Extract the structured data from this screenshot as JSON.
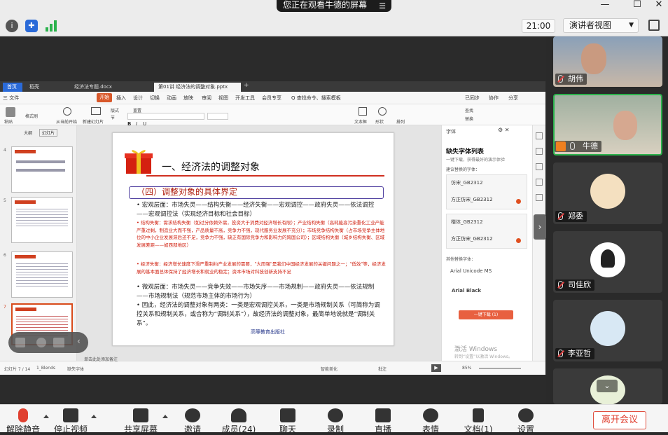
{
  "top": {
    "share_banner": "您正在观看牛德的屏幕",
    "clock": "21:00",
    "presenter_view": "演讲者视图"
  },
  "screen": {
    "tabs": [
      "首页",
      "稻壳",
      "经济法专题.docx",
      "第01讲 经济法的调整对象.pptx"
    ],
    "menu": [
      "三 文件",
      "开始",
      "插入",
      "设计",
      "切换",
      "动画",
      "放映",
      "审阅",
      "视图",
      "开发工具",
      "会员专享",
      "Q 查找命令、搜索模板",
      "已同步",
      "协作",
      "分享"
    ],
    "ribbon": [
      "粘贴",
      "格式刷",
      "从当前开始",
      "新建幻灯片",
      "版式",
      "节",
      "重置",
      "文本框",
      "形状",
      "排列",
      "查找",
      "替换"
    ],
    "thumb_tabs": [
      "大纲",
      "幻灯片"
    ],
    "thumb_numbers": [
      "4",
      "5",
      "6",
      "7"
    ],
    "slide": {
      "title": "一、经济法的调整对象",
      "subtitle": "（四）调整对象的具体界定",
      "para1": "•  宏观层面：市场失灵——结构失衡——经济失衡——宏观调控——政府失灵——依法调控——宏观调控法（实现经济目标和社会目标）",
      "para2": "• 结构失衡：需求结构失衡（如过分依赖外需，投资大于消费对经济增长有限）；产业结构失衡（高耗能高污染重化工业产能严重过剩，制造业大而不强，产品质量不高，竞争力不强，现代服务业发展不充分）；市场竞争结构失衡（占市场竞争主体地位的中小企业发展滞后还不足，竞争力不强，缺乏有国际竞争力和影响力的跨国公司）；区域结构失衡（城乡结构失衡、区域发展差距——如西部地区）",
      "para3": "• 经济失衡：经济增长速度下滑严重制约产业发展的需要，\"大而强\"是我们中国经济发展的关键问题之一；\"低效\"等，经济发展的基本面总体保持了经济增长和就业的稳定；资本市场对科技创新支持不足",
      "para4": "•  微观层面：市场失灵——竞争失效——市场失序——市场规制——政府失灵——依法规制——市场规制法（规范市场主体的市场行为）",
      "para5": "•  因此，经济法的调整对象有两类：一类是宏观调控关系，一类是市场规制关系（可简称为调控关系和规制关系，或合称为“调制关系”），故经济法的调整对象，最简单地说就是“调制关系”。",
      "publisher": "高等教育出版社"
    },
    "font_panel": {
      "header": "字体",
      "title": "缺失字体列表",
      "subtitle": "一键下载，获得最好的演示体验",
      "recommend": "建议替换的字体：",
      "item1_name": "仿宋_GB2312",
      "item1_value": "方正仿宋_GB2312",
      "item2_name": "楷体_GB2312",
      "item2_value": "方正仿宋_GB2312",
      "other_label": "其他替换字体：",
      "item3": "Arial Unicode MS",
      "item4": "Arial Black",
      "download": "一键下载 (1)",
      "watermark1": "激活 Windows",
      "watermark2": "转到“设置”以激活 Windows。"
    },
    "status": {
      "slide_count": "幻灯片 7 / 14",
      "theme": "1_Blends",
      "missing_font": "缺失字体",
      "notes": "单击此处添加备注",
      "beautify": "智能美化",
      "comment": "批注",
      "zoom": "85%"
    }
  },
  "participants": [
    {
      "name": "胡伟"
    },
    {
      "name": "牛德"
    },
    {
      "name": "郑委"
    },
    {
      "name": "司佳欣"
    },
    {
      "name": "李亚哲"
    }
  ],
  "toolbar": {
    "unmute": "解除静音",
    "stop_video": "停止视频",
    "share": "共享屏幕",
    "invite": "邀请",
    "members": "成员(24)",
    "chat": "聊天",
    "record": "录制",
    "live": "直播",
    "reactions": "表情",
    "docs": "文档(1)",
    "settings": "设置",
    "leave": "离开会议"
  },
  "colors": {
    "accent_red": "#e04030",
    "slide_red": "#d02010",
    "wps_orange": "#d8582a"
  }
}
